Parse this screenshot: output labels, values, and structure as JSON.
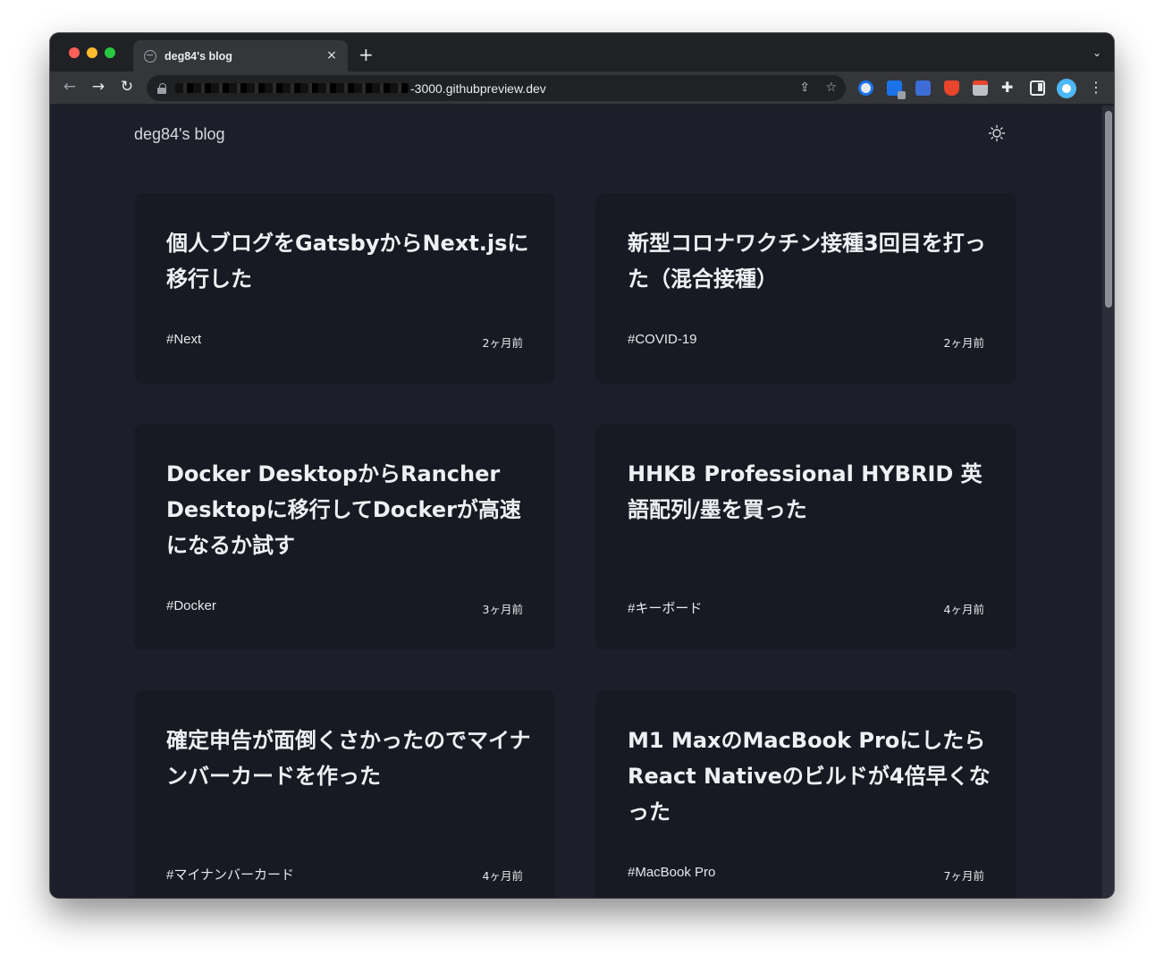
{
  "browser": {
    "tab_title": "deg84's blog",
    "tab_close": "×",
    "new_tab": "+",
    "tab_search": "⌄",
    "url_visible": "-3000.githubpreview.dev"
  },
  "site": {
    "title": "deg84's blog"
  },
  "posts": [
    {
      "title": "個人ブログをGatsbyからNext.jsに移行した",
      "tag": "#Next",
      "date": "2ヶ月前"
    },
    {
      "title": "新型コロナワクチン接種3回目を打った（混合接種）",
      "tag": "#COVID-19",
      "date": "2ヶ月前"
    },
    {
      "title": "Docker DesktopからRancher Desktopに移行してDockerが高速になるか試す",
      "tag": "#Docker",
      "date": "3ヶ月前"
    },
    {
      "title": "HHKB Professional HYBRID 英語配列/墨を買った",
      "tag": "#キーボード",
      "date": "4ヶ月前"
    },
    {
      "title": "確定申告が面倒くさかったのでマイナンバーカードを作った",
      "tag": "#マイナンバーカード",
      "date": "4ヶ月前"
    },
    {
      "title": "M1 MaxのMacBook ProにしたらReact Nativeのビルドが4倍早くなった",
      "tag": "#MacBook Pro",
      "date": "7ヶ月前"
    }
  ]
}
